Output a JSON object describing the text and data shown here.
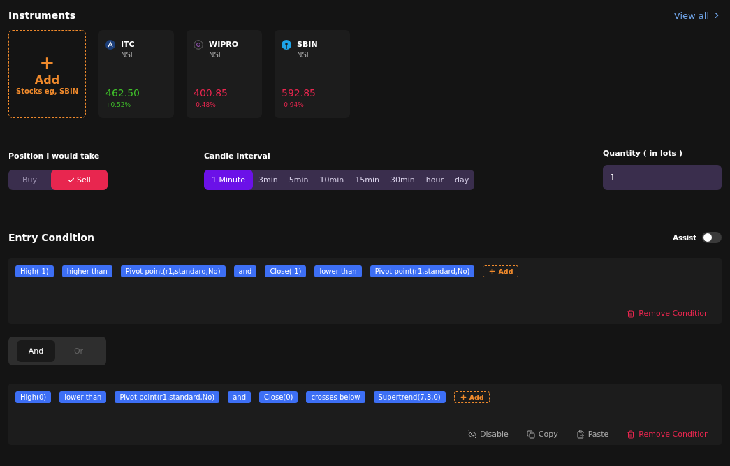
{
  "instruments": {
    "title": "Instruments",
    "view_all": "View all",
    "add_card": {
      "plus": "+",
      "label": "Add",
      "hint": "Stocks eg, SBIN"
    },
    "items": [
      {
        "symbol": "ITC",
        "exchange": "NSE",
        "price": "462.50",
        "change": "+0.52%",
        "color": "#3fbf2a",
        "kind": "itc"
      },
      {
        "symbol": "WIPRO",
        "exchange": "NSE",
        "price": "400.85",
        "change": "-0.48%",
        "color": "#e8264f",
        "kind": "wipro"
      },
      {
        "symbol": "SBIN",
        "exchange": "NSE",
        "price": "592.85",
        "change": "-0.94%",
        "color": "#e8264f",
        "kind": "sbin"
      }
    ]
  },
  "position": {
    "label": "Position I would take",
    "options": [
      {
        "label": "Buy",
        "selected": false
      },
      {
        "label": "Sell",
        "selected": true
      }
    ]
  },
  "candle_interval": {
    "label": "Candle Interval",
    "options": [
      {
        "label": "1 Minute",
        "selected": true
      },
      {
        "label": "3min",
        "selected": false
      },
      {
        "label": "5min",
        "selected": false
      },
      {
        "label": "10min",
        "selected": false
      },
      {
        "label": "15min",
        "selected": false
      },
      {
        "label": "30min",
        "selected": false
      },
      {
        "label": "hour",
        "selected": false
      },
      {
        "label": "day",
        "selected": false
      }
    ]
  },
  "quantity": {
    "label": "Quantity ( in lots )",
    "value": "1"
  },
  "entry_condition": {
    "title": "Entry Condition",
    "assist": {
      "label": "Assist",
      "on": false
    },
    "conditions": [
      {
        "tokens": [
          "High(-1)",
          "higher than",
          "Pivot point(r1,standard,No)",
          "and",
          "Close(-1)",
          "lower than",
          "Pivot point(r1,standard,No)"
        ],
        "add_label": "Add",
        "actions": [
          {
            "kind": "remove",
            "label": "Remove Condition"
          }
        ]
      },
      {
        "tokens": [
          "High(0)",
          "lower than",
          "Pivot point(r1,standard,No)",
          "and",
          "Close(0)",
          "crosses below",
          "Supertrend(7,3,0)"
        ],
        "add_label": "Add",
        "actions": [
          {
            "kind": "disable",
            "label": "Disable"
          },
          {
            "kind": "copy",
            "label": "Copy"
          },
          {
            "kind": "paste",
            "label": "Paste"
          },
          {
            "kind": "remove",
            "label": "Remove Condition"
          }
        ]
      }
    ],
    "joiner": {
      "options": [
        {
          "label": "And",
          "selected": true
        },
        {
          "label": "Or",
          "selected": false
        }
      ]
    }
  }
}
